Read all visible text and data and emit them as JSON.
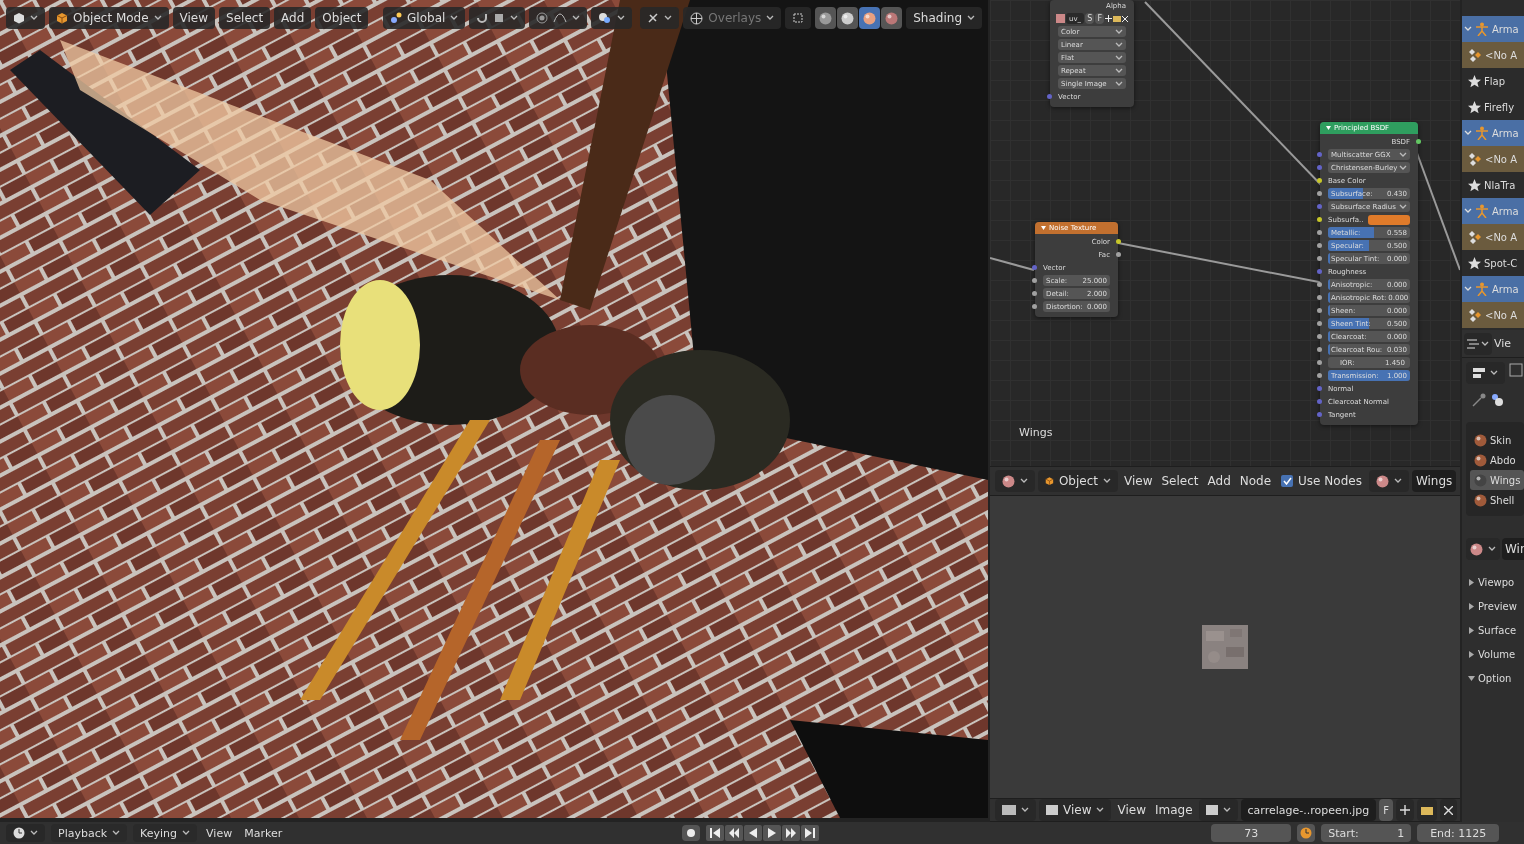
{
  "viewport_header": {
    "mode": "Object Mode",
    "menus": [
      "View",
      "Select",
      "Add",
      "Object"
    ],
    "orientation": "Global",
    "overlays": "Overlays",
    "shading": "Shading",
    "shading_modes": [
      {
        "selected": false
      },
      {
        "selected": false
      },
      {
        "selected": true
      },
      {
        "selected": false
      }
    ]
  },
  "node_editor": {
    "label": "Wings",
    "image_node": {
      "title": "Alpha",
      "image_name": "uv_",
      "buttons": [
        "S",
        "F"
      ],
      "dropdowns": [
        "Color",
        "Linear",
        "Flat",
        "Repeat",
        "Single Image"
      ],
      "input": "Vector"
    },
    "noise_node": {
      "title": "Noise Texture",
      "outputs": [
        "Color",
        "Fac"
      ],
      "input": "Vector",
      "fields": [
        {
          "label": "Scale:",
          "value": "25.000"
        },
        {
          "label": "Detail:",
          "value": "2.000"
        },
        {
          "label": "Distortion:",
          "value": "0.000"
        }
      ]
    },
    "bsdf_node": {
      "title": "Principled BSDF",
      "output": "BSDF",
      "rows": [
        {
          "kind": "dropdown",
          "label": "Multiscatter GGX"
        },
        {
          "kind": "dropdown",
          "label": "Christensen-Burley"
        },
        {
          "kind": "socket",
          "label": "Base Color"
        },
        {
          "kind": "slider",
          "label": "Subsurface:",
          "value": "0.430",
          "level": 0.43
        },
        {
          "kind": "dropdown",
          "label": "Subsurface Radius"
        },
        {
          "kind": "color",
          "label": "Subsurfa..",
          "color": "#e07b2a"
        },
        {
          "kind": "slider",
          "label": "Metallic:",
          "value": "0.558",
          "level": 0.558
        },
        {
          "kind": "slider",
          "label": "Specular:",
          "value": "0.500",
          "level": 0.5
        },
        {
          "kind": "slider",
          "label": "Specular Tint:",
          "value": "0.000",
          "level": 0
        },
        {
          "kind": "socket",
          "label": "Roughness"
        },
        {
          "kind": "slider",
          "label": "Anisotropic:",
          "value": "0.000",
          "level": 0
        },
        {
          "kind": "slider",
          "label": "Anisotropic Rot:",
          "value": "0.000",
          "level": 0
        },
        {
          "kind": "slider",
          "label": "Sheen:",
          "value": "0.000",
          "level": 0
        },
        {
          "kind": "slider",
          "label": "Sheen Tint:",
          "value": "0.500",
          "level": 0.5
        },
        {
          "kind": "slider",
          "label": "Clearcoat:",
          "value": "0.000",
          "level": 0
        },
        {
          "kind": "slider",
          "label": "Clearcoat Rou:",
          "value": "0.030",
          "level": 0.03
        },
        {
          "kind": "number",
          "label": "IOR:",
          "value": "1.450"
        },
        {
          "kind": "slider",
          "label": "Transmission:",
          "value": "1.000",
          "level": 1
        },
        {
          "kind": "socket",
          "label": "Normal"
        },
        {
          "kind": "socket",
          "label": "Clearcoat Normal"
        },
        {
          "kind": "socket",
          "label": "Tangent"
        }
      ]
    }
  },
  "node_header": {
    "object_type": "Object",
    "menus": [
      "View",
      "Select",
      "Add",
      "Node"
    ],
    "use_nodes": {
      "label": "Use Nodes",
      "checked": true
    },
    "material": "Wings"
  },
  "image_header": {
    "view_mode": "View",
    "menus": [
      "View",
      "Image"
    ],
    "image": "carrelage-..ropeen.jpg",
    "fake_user": "F"
  },
  "outliner": [
    {
      "kind": "armature",
      "label": "Arma",
      "selected": true,
      "expanded": true
    },
    {
      "kind": "action",
      "label": "<No A",
      "selected": false
    },
    {
      "kind": "strip",
      "label": "Flap",
      "selected": false
    },
    {
      "kind": "strip",
      "label": "Firefly",
      "selected": false
    },
    {
      "kind": "armature",
      "label": "Arma",
      "selected": true,
      "expanded": true
    },
    {
      "kind": "action",
      "label": "<No A",
      "selected": false
    },
    {
      "kind": "strip",
      "label": "NlaTra",
      "selected": false
    },
    {
      "kind": "armature",
      "label": "Arma",
      "selected": true,
      "expanded": true
    },
    {
      "kind": "action",
      "label": "<No A",
      "selected": false
    },
    {
      "kind": "strip",
      "label": "Spot-C",
      "selected": false
    },
    {
      "kind": "armature",
      "label": "Arma",
      "selected": true,
      "expanded": true
    },
    {
      "kind": "action",
      "label": "<No A",
      "selected": false
    }
  ],
  "properties": {
    "view_label": "Vie",
    "material_slots": [
      {
        "label": "Skin",
        "selected": false
      },
      {
        "label": "Abdo",
        "selected": false
      },
      {
        "label": "Wings",
        "selected": true
      },
      {
        "label": "Shell",
        "selected": false
      }
    ],
    "material_name": "Wir",
    "panels": [
      {
        "label": "Viewpo",
        "expanded": false
      },
      {
        "label": "Preview",
        "expanded": false
      },
      {
        "label": "Surface",
        "expanded": false
      },
      {
        "label": "Volume",
        "expanded": false
      },
      {
        "label": "Option",
        "expanded": true
      }
    ]
  },
  "timeline": {
    "menus": [
      "Playback",
      "Keying"
    ],
    "links": [
      "View",
      "Marker"
    ],
    "frame": "73",
    "start": {
      "label": "Start:",
      "value": "1"
    },
    "end": "End: 1125"
  }
}
